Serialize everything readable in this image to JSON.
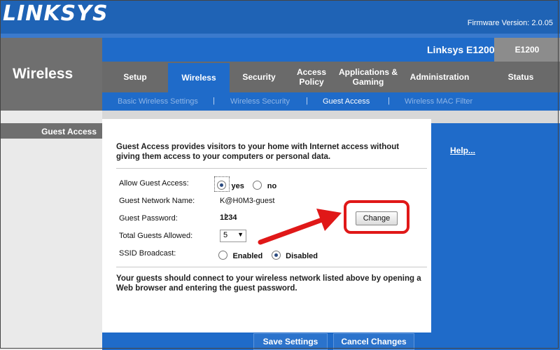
{
  "header": {
    "logo": "LINKSYS",
    "firmware": "Firmware Version: 2.0.05",
    "section_title": "Wireless",
    "model_name": "Linksys E1200",
    "model_short": "E1200"
  },
  "tabs": [
    {
      "label": "Setup"
    },
    {
      "label": "Wireless"
    },
    {
      "label": "Security"
    },
    {
      "label": "Access Policy"
    },
    {
      "label": "Applications & Gaming"
    },
    {
      "label": "Administration"
    },
    {
      "label": "Status"
    }
  ],
  "subnav": [
    {
      "label": "Basic Wireless Settings"
    },
    {
      "label": "Wireless Security"
    },
    {
      "label": "Guest Access"
    },
    {
      "label": "Wireless MAC Filter"
    }
  ],
  "left": {
    "label": "Guest Access"
  },
  "help": "Help...",
  "intro": "Guest Access provides visitors to your home with Internet access without giving them access to your computers or personal data.",
  "form": {
    "allow_label": "Allow Guest Access:",
    "allow_yes": "yes",
    "allow_no": "no",
    "name_label": "Guest Network Name:",
    "name_value": "K@H0M3-guest",
    "password_label": "Guest Password:",
    "password_value": "1234",
    "change_label": "Change",
    "total_label": "Total Guests Allowed:",
    "total_value": "5",
    "ssid_label": "SSID Broadcast:",
    "ssid_enabled": "Enabled",
    "ssid_disabled": "Disabled"
  },
  "footer_text": "Your guests should connect to your wireless network listed above by opening a Web browser and entering the guest password.",
  "buttons": {
    "save": "Save Settings",
    "cancel": "Cancel Changes"
  },
  "colors": {
    "brand_blue": "#1f6bc9",
    "highlight_red": "#e01818"
  }
}
